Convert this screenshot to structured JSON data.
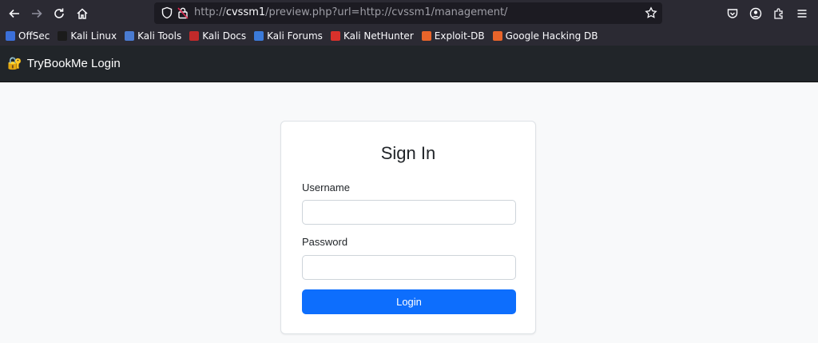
{
  "browser": {
    "url_prefix": "http://",
    "url_host": "cvssm1",
    "url_rest": "/preview.php?url=http://cvssm1/management/"
  },
  "bookmarks": [
    {
      "label": "OffSec",
      "color": "#3b6fd9"
    },
    {
      "label": "Kali Linux",
      "color": "#1b1b1b"
    },
    {
      "label": "Kali Tools",
      "color": "#4a7bd1"
    },
    {
      "label": "Kali Docs",
      "color": "#c22a2a"
    },
    {
      "label": "Kali Forums",
      "color": "#3b7ad9"
    },
    {
      "label": "Kali NetHunter",
      "color": "#d9312b"
    },
    {
      "label": "Exploit-DB",
      "color": "#e8642a"
    },
    {
      "label": "Google Hacking DB",
      "color": "#e8642a"
    }
  ],
  "navbar": {
    "brand_icon": "🔐",
    "brand": "TryBookMe Login"
  },
  "login": {
    "title": "Sign In",
    "username_label": "Username",
    "username_value": "",
    "password_label": "Password",
    "password_value": "",
    "submit_label": "Login",
    "accent": "#0d6efd"
  }
}
